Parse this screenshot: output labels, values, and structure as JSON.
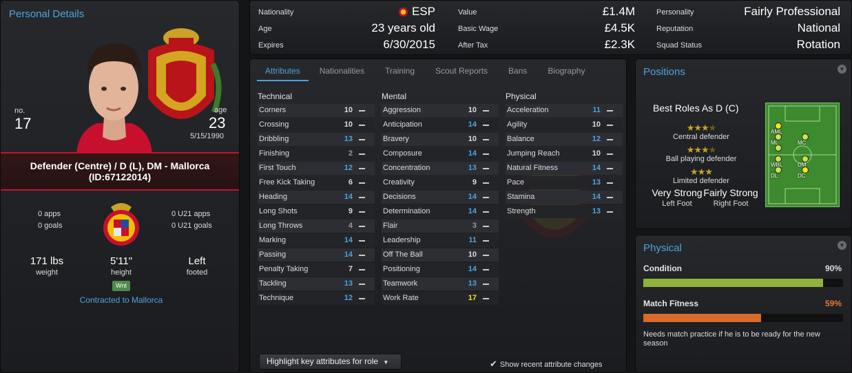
{
  "personal": {
    "title": "Personal Details",
    "no_label": "no.",
    "no_value": "17",
    "age_label": "age",
    "age_value": "23",
    "dob": "5/15/1990",
    "position_line1": "Defender (Centre) / D (L), DM - Mallorca",
    "position_line2": "(ID:67122014)",
    "apps": "0 apps",
    "goals": "0 goals",
    "u21_apps": "0 U21 apps",
    "u21_goals": "0 U21 goals",
    "weight_value": "171 lbs",
    "weight_label": "weight",
    "height_value": "5'11\"",
    "height_label": "height",
    "foot_value": "Left",
    "foot_label": "footed",
    "badge": "Wnt",
    "contract": "Contracted to Mallorca"
  },
  "info": [
    [
      {
        "label": "Nationality",
        "value": "ESP",
        "flag": "spain-flag-icon"
      },
      {
        "label": "Value",
        "value": "£1.4M"
      },
      {
        "label": "Personality",
        "value": "Fairly Professional"
      }
    ],
    [
      {
        "label": "Age",
        "value": "23 years old"
      },
      {
        "label": "Basic Wage",
        "value": "£4.5K"
      },
      {
        "label": "Reputation",
        "value": "National"
      }
    ],
    [
      {
        "label": "Expires",
        "value": "6/30/2015"
      },
      {
        "label": "After Tax",
        "value": "£2.3K"
      },
      {
        "label": "Squad Status",
        "value": "Rotation"
      }
    ]
  ],
  "tabs": [
    "Attributes",
    "Nationalities",
    "Training",
    "Scout Reports",
    "Bans",
    "Biography"
  ],
  "attributes": {
    "technical": {
      "title": "Technical",
      "items": [
        [
          "Corners",
          10
        ],
        [
          "Crossing",
          10
        ],
        [
          "Dribbling",
          13
        ],
        [
          "Finishing",
          2
        ],
        [
          "First Touch",
          12
        ],
        [
          "Free Kick Taking",
          6
        ],
        [
          "Heading",
          14
        ],
        [
          "Long Shots",
          9
        ],
        [
          "Long Throws",
          4
        ],
        [
          "Marking",
          14
        ],
        [
          "Passing",
          14
        ],
        [
          "Penalty Taking",
          7
        ],
        [
          "Tackling",
          13
        ],
        [
          "Technique",
          12
        ]
      ]
    },
    "mental": {
      "title": "Mental",
      "items": [
        [
          "Aggression",
          10
        ],
        [
          "Anticipation",
          14
        ],
        [
          "Bravery",
          10
        ],
        [
          "Composure",
          14
        ],
        [
          "Concentration",
          13
        ],
        [
          "Creativity",
          9
        ],
        [
          "Decisions",
          14
        ],
        [
          "Determination",
          14
        ],
        [
          "Flair",
          3
        ],
        [
          "Leadership",
          11
        ],
        [
          "Off The Ball",
          10
        ],
        [
          "Positioning",
          14
        ],
        [
          "Teamwork",
          13
        ],
        [
          "Work Rate",
          17
        ]
      ]
    },
    "physical": {
      "title": "Physical",
      "items": [
        [
          "Acceleration",
          11
        ],
        [
          "Agility",
          10
        ],
        [
          "Balance",
          12
        ],
        [
          "Jumping Reach",
          10
        ],
        [
          "Natural Fitness",
          14
        ],
        [
          "Pace",
          13
        ],
        [
          "Stamina",
          14
        ],
        [
          "Strength",
          13
        ]
      ]
    }
  },
  "highlight_button": "Highlight key attributes for role",
  "show_recent": "Show recent attribute changes",
  "positions": {
    "title": "Positions",
    "best_roles": "Best Roles As D (C)",
    "roles": [
      {
        "name": "Central defender",
        "stars": 3.5
      },
      {
        "name": "Ball playing defender",
        "stars": 3.5
      },
      {
        "name": "Limited defender",
        "stars": 3
      }
    ],
    "left_foot_value": "Very Strong",
    "left_foot_label": "Left Foot",
    "right_foot_value": "Fairly Strong",
    "right_foot_label": "Right Foot",
    "pitch_labels": [
      "AML",
      "ML",
      "MC",
      "WBL",
      "DM",
      "DL",
      "DC"
    ]
  },
  "physical": {
    "title": "Physical",
    "condition_label": "Condition",
    "condition_value": "90%",
    "condition_level": 0.9,
    "fitness_label": "Match Fitness",
    "fitness_value": "59%",
    "fitness_level": 0.59,
    "note": "Needs match practice if he is to be ready for the new season",
    "colors": {
      "condition": "#8fb33a",
      "fitness": "#d96a2a"
    }
  }
}
